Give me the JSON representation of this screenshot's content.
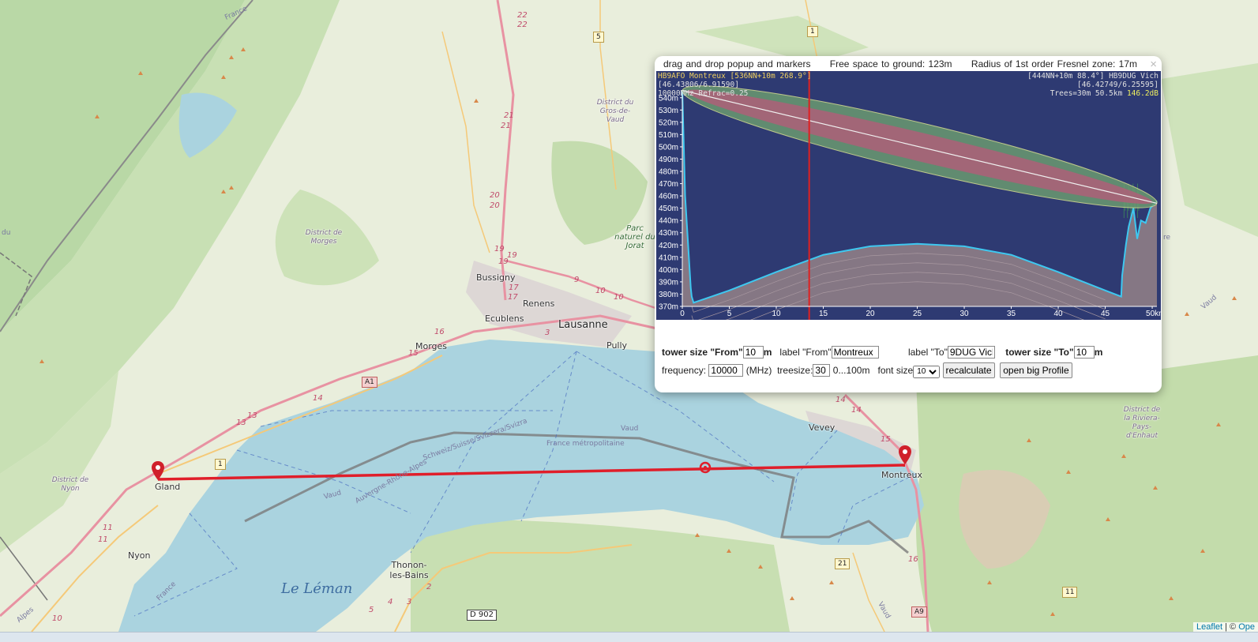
{
  "map": {
    "lake_name": "Le Léman",
    "places": {
      "lausanne": "Lausanne",
      "morges": "Morges",
      "bussigny": "Bussigny",
      "renens": "Renens",
      "ecublens": "Ecublens",
      "pully": "Pully",
      "vevey": "Vevey",
      "montreux": "Montreux",
      "gland": "Gland",
      "nyon": "Nyon",
      "thonon": "Thonon-les-Bains"
    },
    "districts": {
      "gros_de_vaud": "District du Gros-de-Vaud",
      "morges": "District de Morges",
      "nyon": "District de Nyon",
      "riviera": "District de la Riviera-Pays-d'Enhaut"
    },
    "park": "Parc naturel du Jorat",
    "borders": {
      "swiss": "Schweiz/Suisse/Svizzera/Svizra",
      "france_metro": "France métropolitaine",
      "auvergne": "Auvergne-Rhône-Alpes",
      "vaud1": "Vaud",
      "vaud2": "Vaud",
      "vaud3": "Vaud",
      "france_nw": "France",
      "france_sw": "France",
      "alpes": "Alpes"
    },
    "shields": {
      "a1": "A1",
      "a9": "A9",
      "d902": "D 902",
      "r1a": "1",
      "r1b": "1",
      "r5": "5",
      "r11": "11",
      "r21": "21"
    },
    "route_numbers": {
      "n22a": "22",
      "n22b": "22",
      "n21a": "21",
      "n21b": "21",
      "n20a": "20",
      "n20b": "20",
      "n19a": "19",
      "n19b": "19",
      "n19c": "19",
      "n17a": "17",
      "n17b": "17",
      "n9": "9",
      "n10a": "10",
      "n10b": "10",
      "n16": "16",
      "n15a": "15",
      "n15b": "15",
      "n14a": "14",
      "n14b": "14",
      "n14c": "14",
      "n13a": "13",
      "n13b": "13",
      "n11a": "11",
      "n11b": "11",
      "n10c": "10",
      "n3": "3",
      "n2": "2",
      "n16b": "16",
      "n5": "5",
      "n4": "4",
      "n3b": "3"
    },
    "edge_text": {
      "du": "du",
      "re": "re",
      "vaud_edge": "Vaud"
    }
  },
  "popup": {
    "title_drag": "drag and drop popup and markers",
    "title_free_space": "Free space to ground: 123m",
    "title_fresnel": "Radius of 1st order Fresnel zone: 17m",
    "close": "×",
    "profile": {
      "from_line1": "HB9AFO Montreux [536NN+10m 268.9°]",
      "from_line2": "[46.43806/6.91590]",
      "from_line3": "10000MHz Refrac=0.25",
      "to_line1": "[444NN+10m 88.4°] HB9DUG Vich",
      "to_line2": "[46.42749/6.25595]",
      "to_line3_prefix": "Trees=30m 50.5km",
      "to_line3_db": "146.2dB"
    },
    "controls": {
      "tower_from_label": "tower size \"From\"",
      "tower_from_value": "10",
      "unit_m": "m",
      "label_from_label": "label \"From\"",
      "label_from_value": "Montreux",
      "label_to_label": "label \"To\"",
      "label_to_value": "9DUG Vich",
      "tower_to_label": "tower size \"To\"",
      "tower_to_value": "10",
      "unit_m2": "m",
      "frequency_label": "frequency:",
      "frequency_value": "10000",
      "frequency_unit": "(MHz)",
      "treesize_label": "treesize:",
      "treesize_value": "30",
      "treesize_range": "0...100m",
      "fontsize_label": "font size",
      "fontsize_value": "10",
      "recalculate": "recalculate",
      "open_big_profile": "open big Profile"
    }
  },
  "chart_data": {
    "type": "area",
    "title": "",
    "xlabel": "",
    "ylabel": "",
    "x_unit": "km",
    "xlim": [
      0,
      50.5
    ],
    "ylim": [
      370,
      545
    ],
    "x_ticks": [
      "0",
      "5",
      "10",
      "15",
      "20",
      "25",
      "30",
      "35",
      "40",
      "45",
      "50km"
    ],
    "y_ticks": [
      "370m",
      "380m",
      "390m",
      "400m",
      "410m",
      "420m",
      "430m",
      "440m",
      "450m",
      "460m",
      "470m",
      "480m",
      "490m",
      "500m",
      "510m",
      "520m",
      "530m",
      "540m"
    ],
    "cursor_x": 13.5,
    "series": [
      {
        "name": "",
        "x": [
          0,
          0.3,
          0.9,
          1.0,
          1.2,
          5,
          10,
          15,
          20,
          25,
          30,
          35,
          40,
          45,
          46.7,
          46.8,
          47.2,
          47.5,
          48.0,
          48.4,
          48.8,
          49.3,
          49.8,
          50.5
        ],
        "y": [
          546,
          460,
          385,
          378,
          373,
          383,
          398,
          412,
          419,
          421,
          419,
          412,
          398,
          383,
          378,
          395,
          420,
          435,
          450,
          425,
          440,
          438,
          450,
          456
        ]
      },
      {
        "name": "",
        "x": [
          0,
          50.5
        ],
        "y": [
          546,
          454
        ]
      }
    ],
    "fresnel_radius_m": 17,
    "clearance_m": 123
  },
  "attribution": {
    "leaflet": "Leaflet",
    "sep": " | © ",
    "osm": "Ope"
  },
  "colors": {
    "profile_bg": "#2e3a72",
    "terrain_line": "#3ec8f0",
    "link_line": "#e02020",
    "lake": "#aad3df",
    "land": "#e8efd8",
    "forest": "#add19e"
  }
}
